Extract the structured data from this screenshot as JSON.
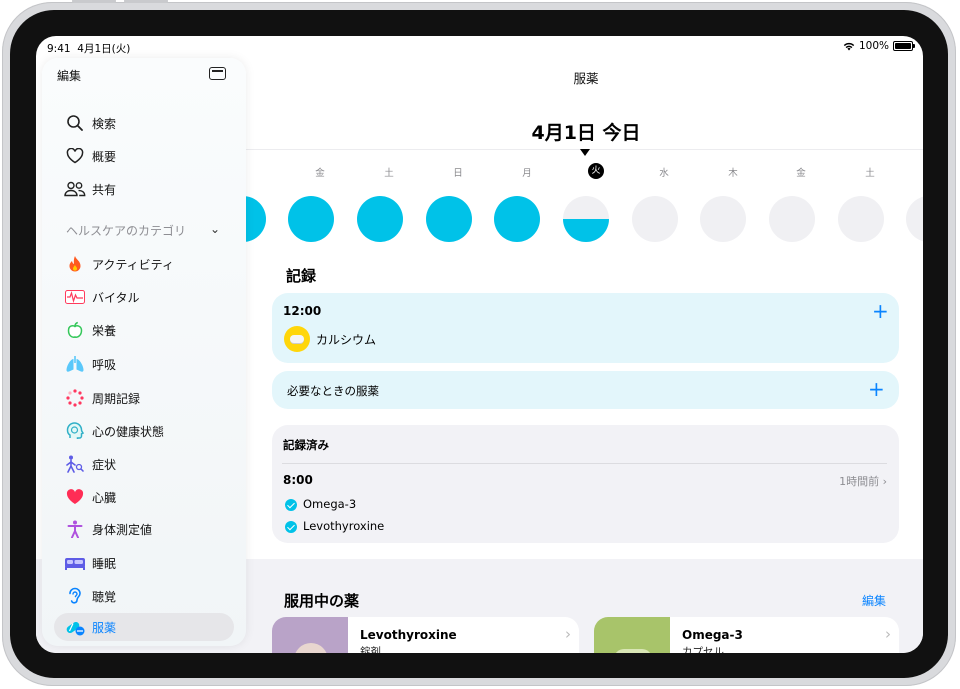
{
  "status": {
    "time": "9:41",
    "date": "4月1日(火)",
    "battery": "100%"
  },
  "header": {
    "title": "服薬",
    "date": "4月1日 今日"
  },
  "week": {
    "days": [
      "金",
      "土",
      "日",
      "月",
      "火",
      "水",
      "木",
      "金",
      "土"
    ],
    "today_index": 4,
    "intake_levels": [
      1,
      1,
      1,
      1,
      1,
      0.5,
      0,
      0,
      0,
      0,
      0
    ]
  },
  "log": {
    "heading": "記録",
    "scheduled_time": "12:00",
    "scheduled_med": "カルシウム",
    "as_needed": "必要なときの服薬",
    "add_symbol": "+"
  },
  "logged": {
    "heading": "記録済み",
    "time": "8:00",
    "ago": "1時間前",
    "meds": [
      "Omega-3",
      "Levothyroxine"
    ]
  },
  "current": {
    "heading": "服用中の薬",
    "edit": "編集",
    "cards": [
      {
        "name": "Levothyroxine",
        "form": "錠剤"
      },
      {
        "name": "Omega-3",
        "form": "カプセル"
      }
    ]
  },
  "sidebar": {
    "edit": "編集",
    "top_items": [
      {
        "label": "検索",
        "icon": "search-icon"
      },
      {
        "label": "概要",
        "icon": "heart-outline-icon"
      },
      {
        "label": "共有",
        "icon": "people-icon"
      }
    ],
    "category_header": "ヘルスケアのカテゴリ",
    "items": [
      {
        "label": "アクティビティ",
        "icon": "flame-icon"
      },
      {
        "label": "バイタル",
        "icon": "waveform-icon"
      },
      {
        "label": "栄養",
        "icon": "apple-icon"
      },
      {
        "label": "呼吸",
        "icon": "lungs-icon"
      },
      {
        "label": "周期記録",
        "icon": "cycle-icon"
      },
      {
        "label": "心の健康状態",
        "icon": "mind-icon"
      },
      {
        "label": "症状",
        "icon": "symptoms-icon"
      },
      {
        "label": "心臓",
        "icon": "heart-icon"
      },
      {
        "label": "身体測定値",
        "icon": "body-icon"
      },
      {
        "label": "睡眠",
        "icon": "bed-icon"
      },
      {
        "label": "聴覚",
        "icon": "ear-icon"
      },
      {
        "label": "服薬",
        "icon": "pills-icon"
      }
    ],
    "active": "服薬"
  },
  "colors": {
    "accent": "#0a84ff",
    "intake": "#00c2e8",
    "card_blue": "#e3f6fb",
    "card_gray": "#f2f2f6"
  }
}
